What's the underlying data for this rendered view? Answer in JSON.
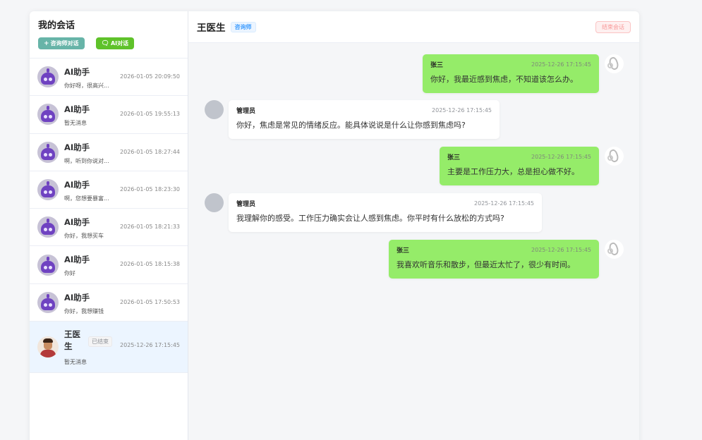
{
  "sidebar": {
    "title": "我的会话",
    "counselor_btn": "咨询师对话",
    "ai_btn": "AI对话",
    "sessions": [
      {
        "name": "AI助手",
        "preview": "你好呀，很高兴...",
        "time": "2026-01-05 20:09:50"
      },
      {
        "name": "AI助手",
        "preview": "暂无消息",
        "time": "2026-01-05 19:55:13"
      },
      {
        "name": "AI助手",
        "preview": "啊，听到你说对...",
        "time": "2026-01-05 18:27:44"
      },
      {
        "name": "AI助手",
        "preview": "啊，您想要暴富...",
        "time": "2026-01-05 18:23:30"
      },
      {
        "name": "AI助手",
        "preview": "你好，我想买车",
        "time": "2026-01-05 18:21:33"
      },
      {
        "name": "AI助手",
        "preview": "你好",
        "time": "2026-01-05 18:15:38"
      },
      {
        "name": "AI助手",
        "preview": "你好，我想赚钱",
        "time": "2026-01-05 17:50:53"
      },
      {
        "name": "王医生",
        "preview": "暂无消息",
        "time": "2025-12-26 17:15:45",
        "tag": "已结束"
      }
    ]
  },
  "chat": {
    "title": "王医生",
    "role_tag": "咨询师",
    "end_btn": "结束会话",
    "messages": [
      {
        "from": "me",
        "name": "张三",
        "time": "2025-12-26 17:15:45",
        "text": "你好，我最近感到焦虑，不知道该怎么办。"
      },
      {
        "from": "other",
        "name": "管理员",
        "time": "2025-12-26 17:15:45",
        "text": "你好，焦虑是常见的情绪反应。能具体说说是什么让你感到焦虑吗?"
      },
      {
        "from": "me",
        "name": "张三",
        "time": "2025-12-26 17:15:45",
        "text": "主要是工作压力大，总是担心做不好。"
      },
      {
        "from": "other",
        "name": "管理员",
        "time": "2025-12-26 17:15:45",
        "text": "我理解你的感受。工作压力确实会让人感到焦虑。你平时有什么放松的方式吗?"
      },
      {
        "from": "me",
        "name": "张三",
        "time": "2025-12-26 17:15:45",
        "text": "我喜欢听音乐和散步，但最近太忙了，很少有时间。"
      }
    ]
  },
  "colors": {
    "my_bubble": "#95ec69",
    "accent_blue": "#409eff",
    "ai_btn": "#5fc22a",
    "counselor_btn": "#67b4a8"
  }
}
